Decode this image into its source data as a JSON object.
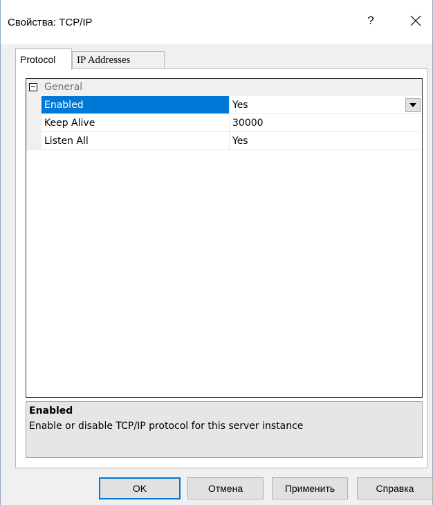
{
  "window": {
    "title": "Свойства: TCP/IP",
    "help_glyph": "?",
    "close_icon": "close-icon"
  },
  "tabs": [
    {
      "label": "Protocol",
      "active": true
    },
    {
      "label": "IP Addresses",
      "active": false
    }
  ],
  "property_grid": {
    "category": {
      "label": "General",
      "expanded": true
    },
    "rows": [
      {
        "name": "Enabled",
        "value": "Yes",
        "selected": true,
        "has_dropdown": true
      },
      {
        "name": "Keep Alive",
        "value": "30000",
        "selected": false,
        "has_dropdown": false
      },
      {
        "name": "Listen All",
        "value": "Yes",
        "selected": false,
        "has_dropdown": false
      }
    ]
  },
  "description": {
    "title": "Enabled",
    "text": "Enable or disable TCP/IP protocol for this server instance"
  },
  "buttons": {
    "ok": "OK",
    "cancel": "Отмена",
    "apply": "Применить",
    "help": "Справка"
  },
  "colors": {
    "selection": "#0078d7",
    "default_button_border": "#0078d7"
  }
}
